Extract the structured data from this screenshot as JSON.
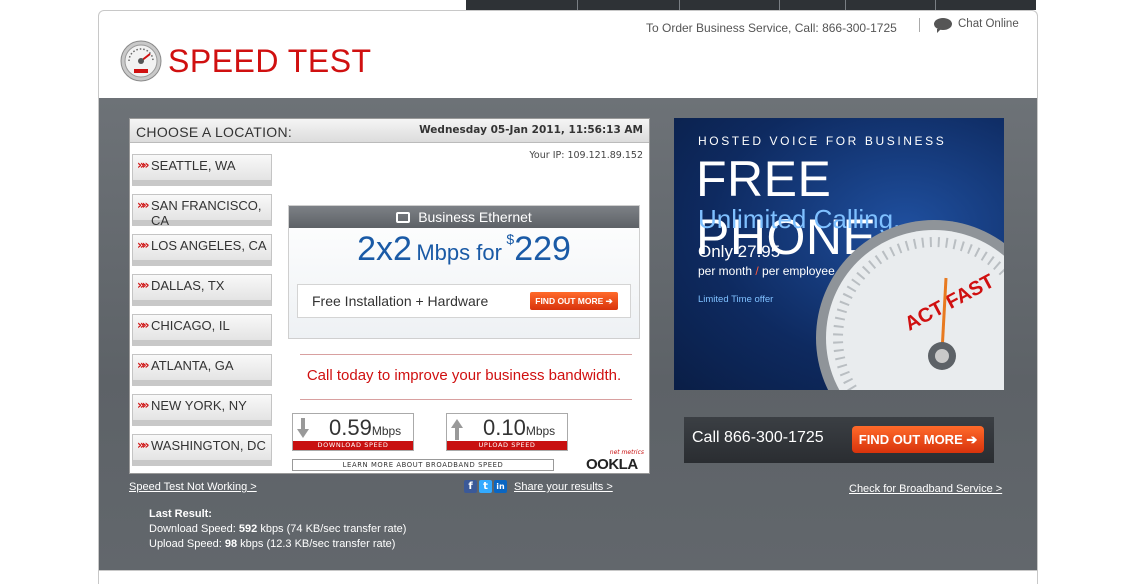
{
  "header": {
    "contact_text": "To Order Business Service, Call: 866-300-1725",
    "chat_label": "Chat Online",
    "logo_text": "SPEED TEST"
  },
  "panel": {
    "choose_title": "CHOOSE A LOCATION:",
    "datetime": "Wednesday 05-Jan 2011, 11:56:13 AM",
    "your_ip": "Your IP: 109.121.89.152",
    "locations": [
      {
        "label": "SEATTLE, WA"
      },
      {
        "label": "SAN FRANCISCO, CA"
      },
      {
        "label": "LOS ANGELES, CA"
      },
      {
        "label": "DALLAS, TX"
      },
      {
        "label": "CHICAGO, IL"
      },
      {
        "label": "ATLANTA, GA"
      },
      {
        "label": "NEW YORK, NY"
      },
      {
        "label": "WASHINGTON, DC"
      }
    ],
    "arrow_glyph": "»»"
  },
  "ethernet_ad": {
    "heading": "Business Ethernet",
    "speed": "2x2",
    "speed_suffix": "Mbps for",
    "price_symbol": "$",
    "price": "229",
    "bar_text": "Free Installation + Hardware",
    "button": "FIND OUT MORE ➔"
  },
  "call_today": "Call today to improve your business bandwidth.",
  "results_meters": {
    "download": {
      "value": "0.59",
      "unit": "Mbps",
      "caption": "DOWNLOAD SPEED"
    },
    "upload": {
      "value": "0.10",
      "unit": "Mbps",
      "caption": "UPLOAD SPEED"
    }
  },
  "learn_more": "LEARN MORE ABOUT BROADBAND SPEED",
  "ookla": {
    "tag": "net metrics",
    "name": "OOKLA"
  },
  "links": {
    "not_working": "Speed Test Not Working >",
    "share": "Share your results >",
    "check_broadband": "Check for Broadband Service >"
  },
  "social": [
    {
      "name": "facebook-icon",
      "glyph": "f",
      "color": "#3b5998"
    },
    {
      "name": "twitter-icon",
      "glyph": "t",
      "color": "#33aaff"
    },
    {
      "name": "linkedin-icon",
      "glyph": "in",
      "color": "#0a66c2"
    }
  ],
  "last_result": {
    "title": "Last Result:",
    "download_label": "Download Speed: ",
    "download_value": "592",
    "download_rest": " kbps (74 KB/sec transfer rate)",
    "upload_label": "Upload Speed: ",
    "upload_value": "98",
    "upload_rest": " kbps (12.3 KB/sec transfer rate)"
  },
  "phone_ad": {
    "hosted": "HOSTED VOICE FOR BUSINESS",
    "free_phone": "FREE PHONE",
    "unlimited": "Unlimited Calling.",
    "only_price": "Only 27.95",
    "per_month": "per month",
    "slash": " / ",
    "per_employee": "per employee",
    "limited": "Limited Time offer",
    "gauge_text": "ACT FAST",
    "call": "Call 866-300-1725",
    "button": "FIND OUT MORE ➔"
  },
  "colors": {
    "brand_red": "#d01010",
    "accent_blue": "#1a5aa6",
    "band_gray": "#62676c"
  }
}
